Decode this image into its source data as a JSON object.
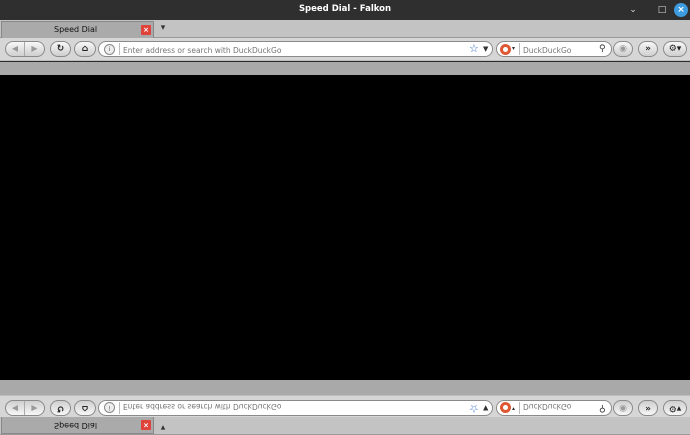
{
  "window": {
    "title": "Speed Dial - Falkon",
    "minimize_icon": "minimize-icon",
    "maximize_icon": "maximize-icon",
    "close_icon": "close-icon"
  },
  "tabs": [
    {
      "label": "Speed Dial",
      "close_icon": "tab-close-icon"
    }
  ],
  "tab_list_icon": "tab-list-icon",
  "navigation": {
    "back_icon": "back-arrow-icon",
    "forward_icon": "forward-arrow-icon",
    "reload_icon": "reload-icon",
    "home_icon": "home-icon",
    "site_icon": "site-info-icon",
    "address_placeholder": "Enter address or search with DuckDuckGo",
    "bookmark_icon": "bookmark-star-icon",
    "history_dropdown_icon": "chevron-down-icon"
  },
  "search": {
    "engine_icon": "duckduckgo-icon",
    "placeholder": "DuckDuckGo",
    "search_icon": "search-icon"
  },
  "toolbar_extras": {
    "adblock_icon": "adblock-icon",
    "more_icon": "chevron-double-right-icon",
    "menu_icon": "gear-icon"
  },
  "colors": {
    "content_background": "#000000",
    "close_button": "#3d9be0",
    "tab_close": "#e0433a",
    "bookmark_star": "#2f66c8",
    "duckduckgo": "#de5833"
  }
}
